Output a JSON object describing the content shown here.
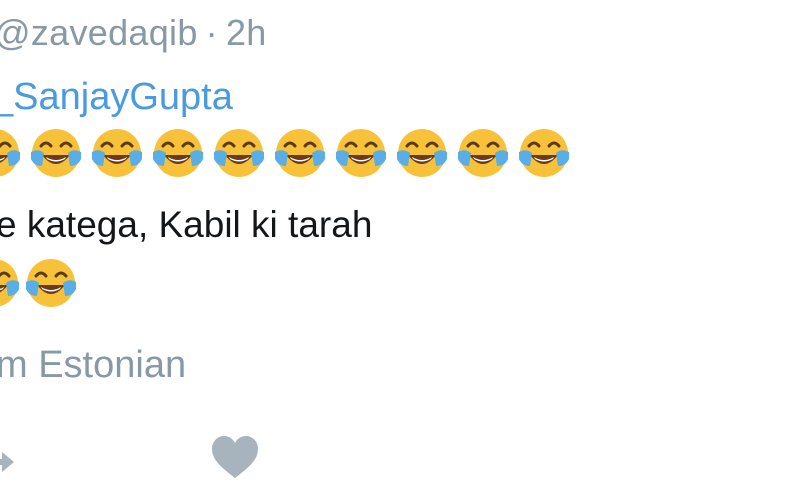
{
  "tweet": {
    "handle": "@zavedaqib",
    "separator": "·",
    "time": "2h",
    "mention": "_SanjayGupta",
    "body_text": "e katega, Kabil ki tarah",
    "translate": "m Estonian"
  },
  "emoji": {
    "name": "face-with-tears-of-joy",
    "row1_count": 10,
    "row2_count": 2
  },
  "actions": {
    "reply_icon": "reply-arrow-icon",
    "like_icon": "heart-icon"
  },
  "colors": {
    "muted": "#8899a6",
    "link": "#4a9ae0",
    "text": "#14171a",
    "emoji_face": "#f7c23a",
    "emoji_tears": "#5aaee8"
  }
}
